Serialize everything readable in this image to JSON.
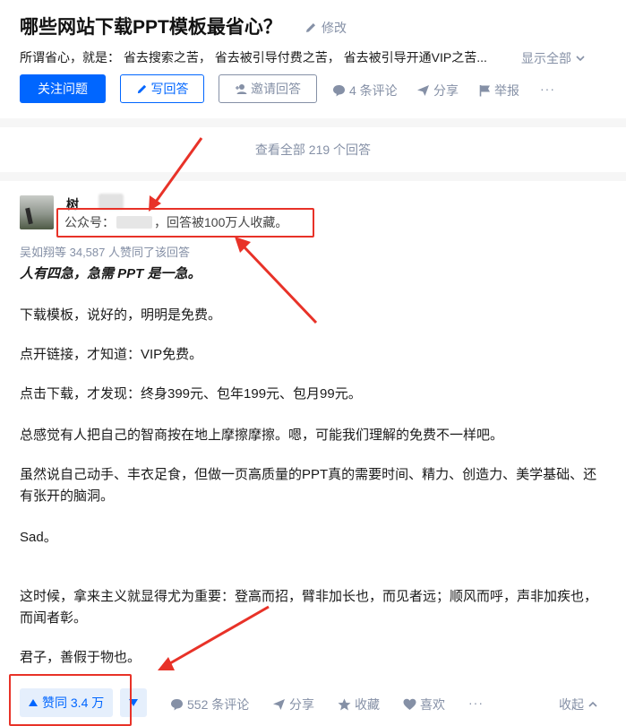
{
  "question": {
    "title": "哪些网站下载PPT模板最省心？",
    "edit_label": "修改",
    "description": "所谓省心，就是：  省去搜索之苦，  省去被引导付费之苦，  省去被引导开通VIP之苦...",
    "show_all_label": "显示全部",
    "buttons": {
      "follow": "关注问题",
      "write": "写回答",
      "invite": "邀请回答"
    },
    "actions": {
      "comments": "4 条评论",
      "share": "分享",
      "report": "举报",
      "more": "···"
    }
  },
  "view_all_answers": "查看全部 219 个回答",
  "answer": {
    "author_name": "树",
    "headline_prefix": "公众号：",
    "headline_suffix": "，回答被100万人收藏。",
    "voters_text": "吴如翔等 34,587 人赞同了该回答",
    "paragraphs": [
      "人有四急，急需 PPT 是一急。",
      "下载模板，说好的，明明是免费。",
      "点开链接，才知道：VIP免费。",
      "点击下载，才发现：终身399元、包年199元、包月99元。",
      "总感觉有人把自己的智商按在地上摩擦摩擦。嗯，可能我们理解的免费不一样吧。",
      "虽然说自己动手、丰衣足食，但做一页高质量的PPT真的需要时间、精力、创造力、美学基础、还有张开的脑洞。",
      "Sad。",
      "这时候，拿来主义就显得尤为重要：登高而招，臂非加长也，而见者远；顺风而呼，声非加疾也，而闻者彰。",
      "君子，善假于物也。"
    ]
  },
  "action_bar": {
    "upvote": "赞同 3.4 万",
    "comments": "552 条评论",
    "share": "分享",
    "favorite": "收藏",
    "like": "喜欢",
    "more": "···",
    "collapse": "收起"
  },
  "colors": {
    "accent": "#0066ff",
    "muted": "#8590a6",
    "annotation_red": "#e83228"
  }
}
